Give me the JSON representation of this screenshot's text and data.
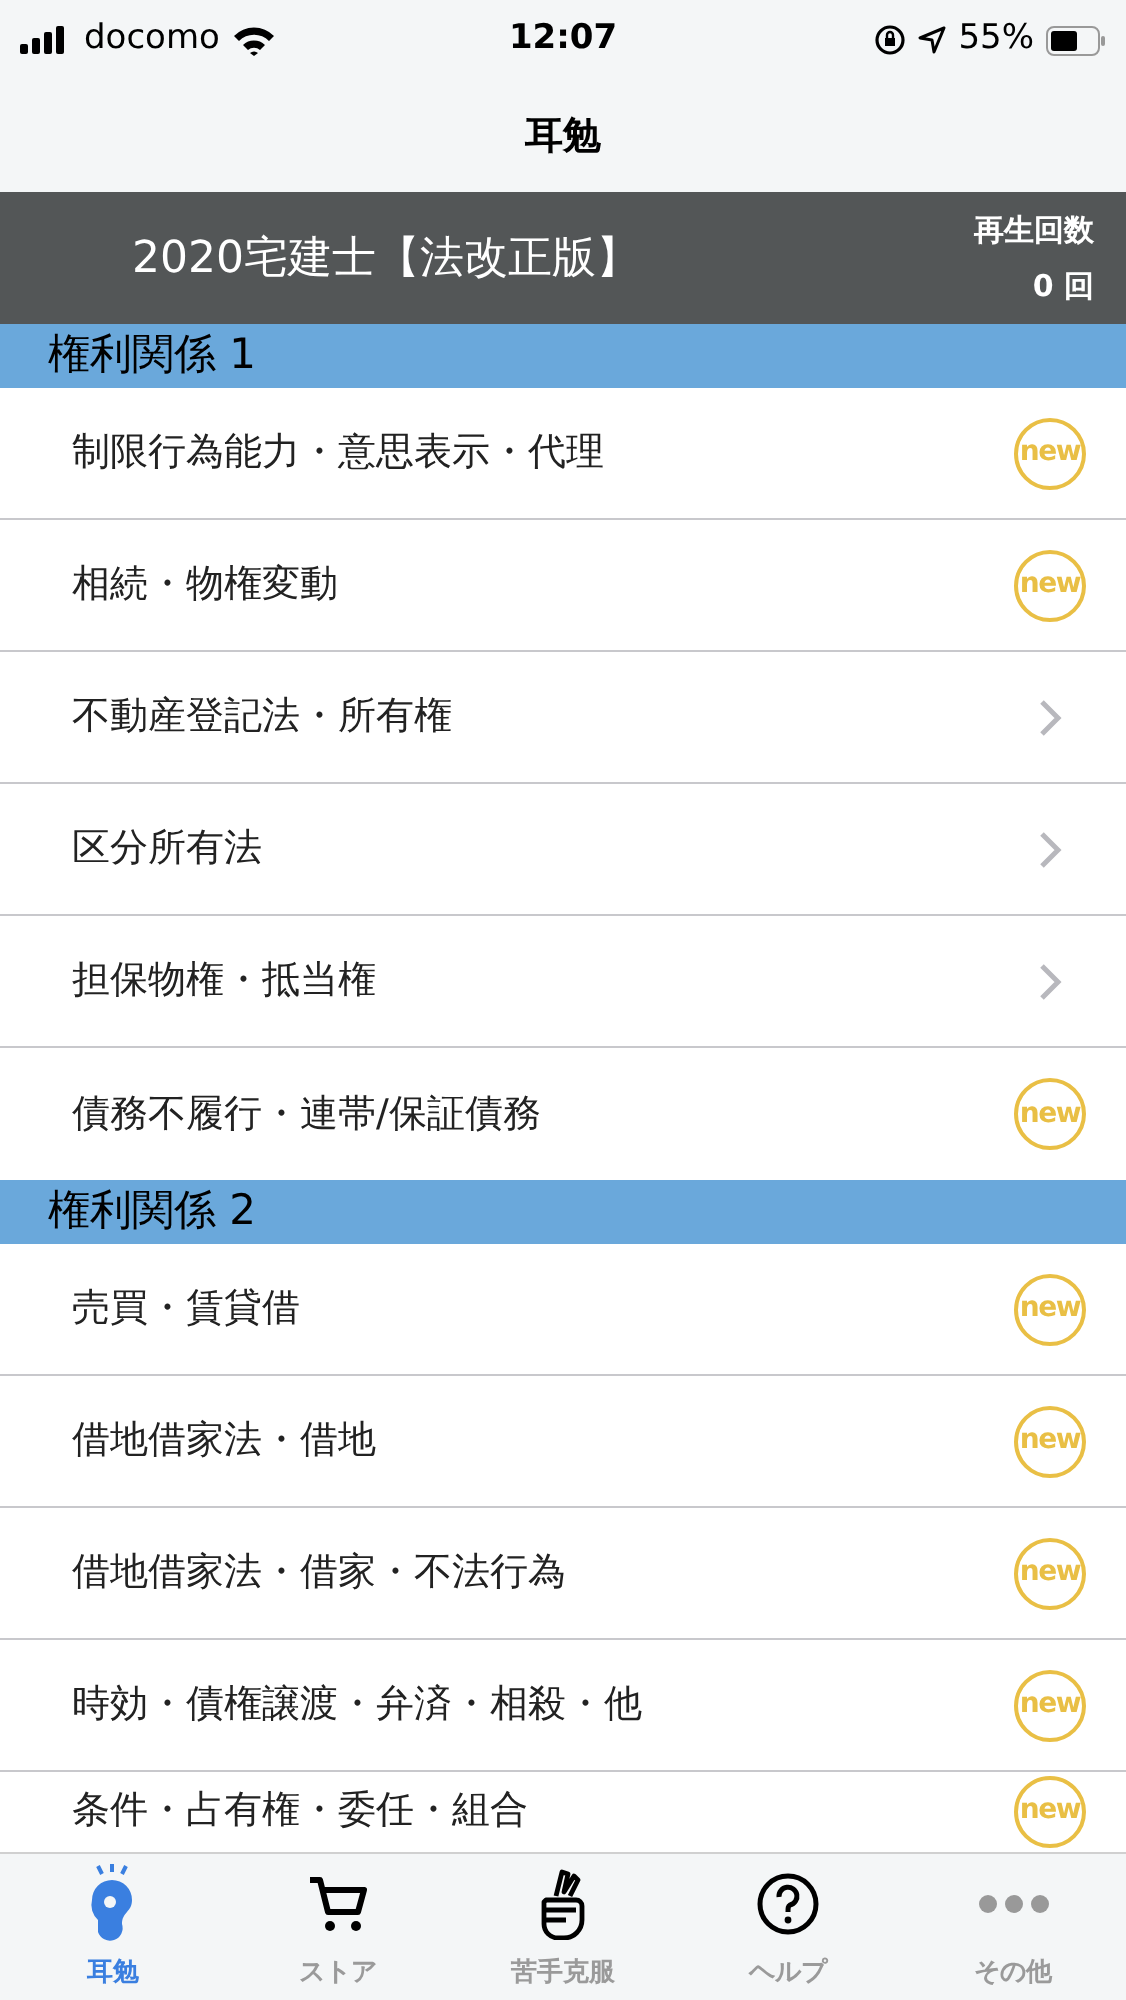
{
  "status_bar": {
    "carrier": "docomo",
    "time": "12:07",
    "battery": "55%"
  },
  "nav": {
    "title": "耳勉"
  },
  "header": {
    "title": "2020宅建士【法改正版】",
    "play_count_label": "再生回数",
    "play_count": "0 回"
  },
  "sections": [
    {
      "title": "権利関係 1",
      "items": [
        {
          "label": "制限行為能力・意思表示・代理",
          "kind": "new",
          "badge": "new"
        },
        {
          "label": "相続・物権変動",
          "kind": "new",
          "badge": "new"
        },
        {
          "label": "不動産登記法・所有権",
          "kind": "chevron"
        },
        {
          "label": "区分所有法",
          "kind": "chevron"
        },
        {
          "label": "担保物権・抵当権",
          "kind": "chevron"
        },
        {
          "label": "債務不履行・連帯/保証債務",
          "kind": "new",
          "badge": "new"
        }
      ]
    },
    {
      "title": "権利関係 2",
      "items": [
        {
          "label": "売買・賃貸借",
          "kind": "new",
          "badge": "new"
        },
        {
          "label": "借地借家法・借地",
          "kind": "new",
          "badge": "new"
        },
        {
          "label": "借地借家法・借家・不法行為",
          "kind": "new",
          "badge": "new"
        },
        {
          "label": "時効・債権譲渡・弁済・相殺・他",
          "kind": "new",
          "badge": "new"
        },
        {
          "label": "条件・占有権・委任・組合",
          "kind": "new",
          "badge": "new"
        }
      ]
    }
  ],
  "tab_bar": [
    {
      "label": "耳勉",
      "kind": "ear",
      "selected": true
    },
    {
      "label": "ストア",
      "kind": "cart",
      "selected": false
    },
    {
      "label": "苦手克服",
      "kind": "fist",
      "selected": false
    },
    {
      "label": "ヘルプ",
      "kind": "help",
      "selected": false
    },
    {
      "label": "その他",
      "kind": "more",
      "selected": false
    }
  ]
}
